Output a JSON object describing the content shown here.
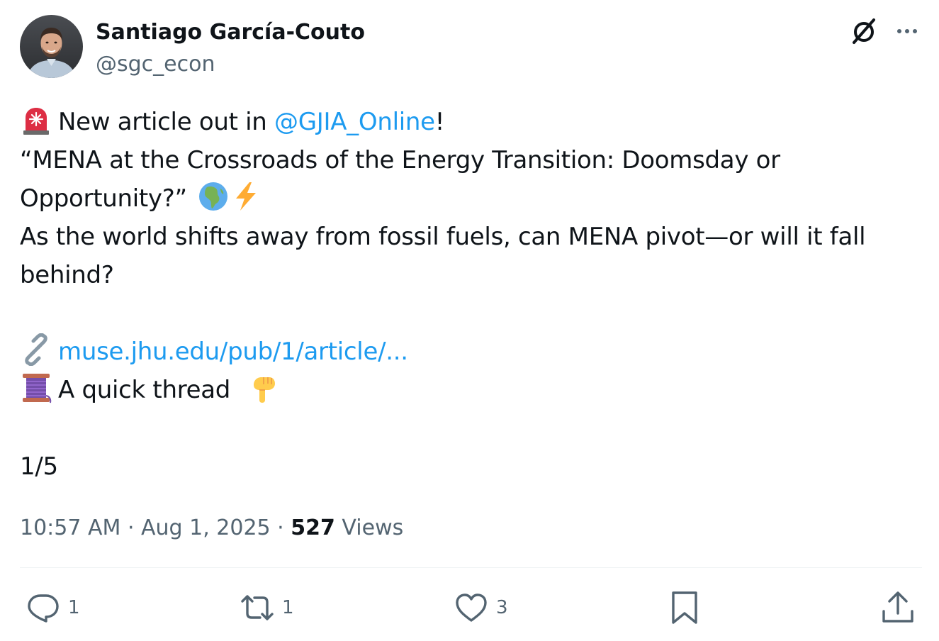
{
  "author": {
    "name": "Santiago García-Couto",
    "handle": "@sgc_econ"
  },
  "tweet": {
    "line1": {
      "emoji": "rotating-light-emoji",
      "prefix": "New article out in ",
      "mention": "@GJIA_Online",
      "suffix": "!"
    },
    "line2": "“MENA at the Crossroads of the Energy Transition: Doomsday or",
    "line3": {
      "text": "Opportunity?”",
      "emojis": [
        "globe-africa-emoji",
        "high-voltage-emoji"
      ]
    },
    "line4": "As the world shifts away from fossil fuels, can MENA pivot—or will it fall",
    "line5": "behind?",
    "line7": {
      "emoji": "link-emoji",
      "url": "muse.jhu.edu/pub/1/article/..."
    },
    "line8": {
      "emoji": "thread-spool-emoji",
      "text": "A quick thread ",
      "trailing_emoji": "pointing-down-emoji"
    },
    "line10": "1/5"
  },
  "meta": {
    "time": "10:57 AM",
    "sep1": " · ",
    "date": "Aug 1, 2025",
    "sep2": " · ",
    "views_count": "527",
    "views_label": " Views"
  },
  "actions": {
    "replies": "1",
    "reposts": "1",
    "likes": "3"
  },
  "colors": {
    "link": "#1d9bf0",
    "text": "#0f1419",
    "secondary": "#536471"
  }
}
